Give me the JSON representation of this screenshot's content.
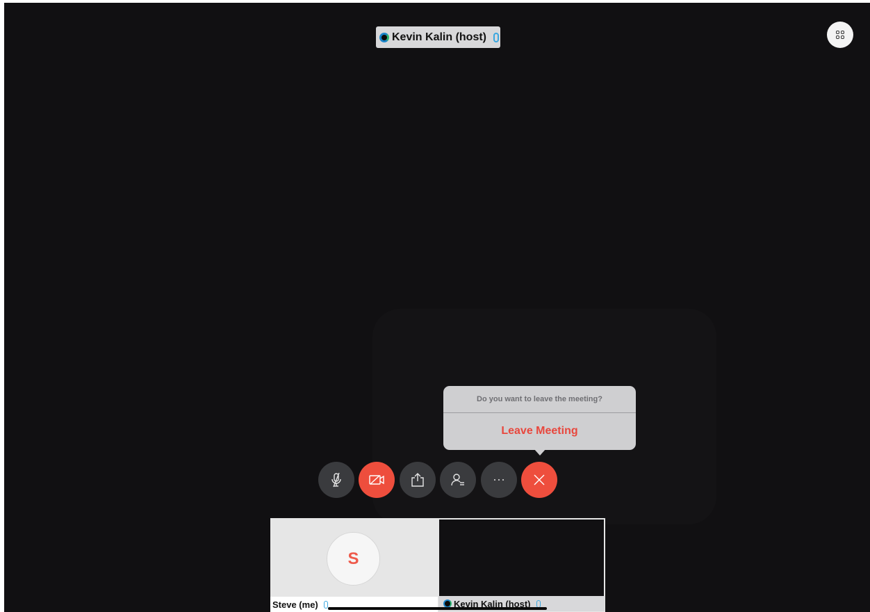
{
  "active_speaker": {
    "name": "Kevin Kalin (host)"
  },
  "layout_button": {
    "icon": "grid-layout-icon"
  },
  "leave_prompt": {
    "question": "Do you want to leave the meeting?",
    "leave_label": "Leave Meeting"
  },
  "controls": [
    {
      "name": "mute",
      "icon": "mic-muted-icon",
      "color": "#3a3b3e"
    },
    {
      "name": "video",
      "icon": "video-off-icon",
      "color": "#ee4e3d"
    },
    {
      "name": "share",
      "icon": "share-icon",
      "color": "#3a3b3e"
    },
    {
      "name": "participants",
      "icon": "participants-icon",
      "color": "#3a3b3e"
    },
    {
      "name": "more",
      "icon": "more-icon",
      "color": "#3a3b3e"
    },
    {
      "name": "end",
      "icon": "close-icon",
      "color": "#ee4e3d"
    }
  ],
  "thumbnails": [
    {
      "name": "Steve (me)",
      "avatar_letter": "S"
    },
    {
      "name": "Kevin Kalin (host)"
    }
  ],
  "colors": {
    "background": "#111012",
    "accent_red": "#ee4e3d",
    "leave_text": "#e8473d",
    "mic_blue": "#3aa7e0"
  }
}
